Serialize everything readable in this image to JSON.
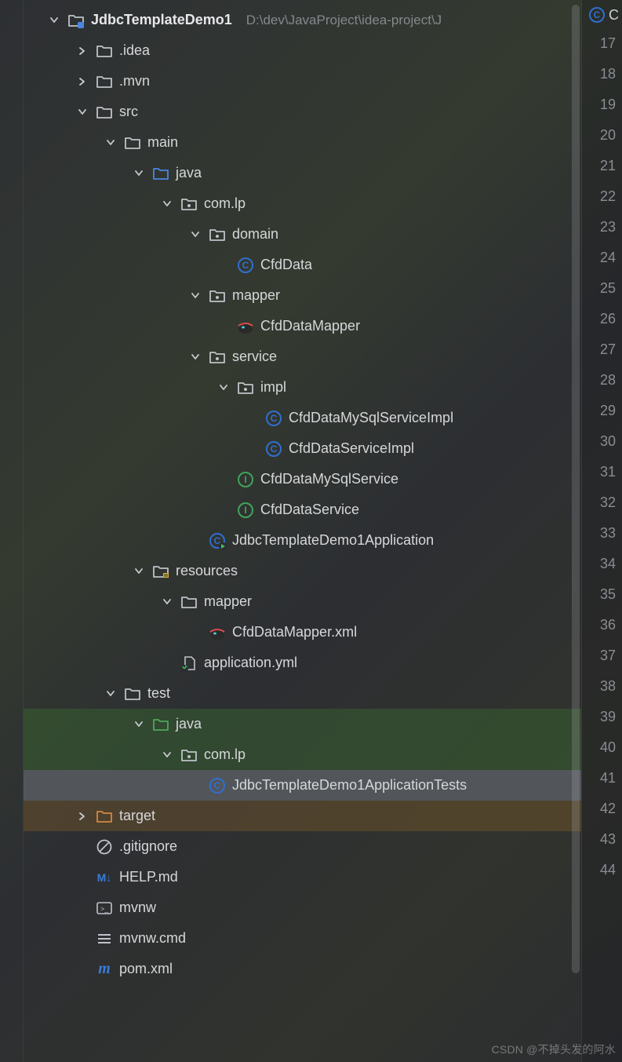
{
  "project": {
    "name": "JdbcTemplateDemo1",
    "path": "D:\\dev\\JavaProject\\idea-project\\J"
  },
  "gutter": {
    "top_letter": "C",
    "start": 17,
    "end": 44
  },
  "tree": [
    {
      "id": "root",
      "depth": 0,
      "arrow": "down",
      "icon": "module-folder",
      "label": "JdbcTemplateDemo1",
      "bold": true,
      "suffix_path": true
    },
    {
      "id": "idea",
      "depth": 1,
      "arrow": "right",
      "icon": "folder",
      "label": ".idea"
    },
    {
      "id": "mvn",
      "depth": 1,
      "arrow": "right",
      "icon": "folder",
      "label": ".mvn"
    },
    {
      "id": "src",
      "depth": 1,
      "arrow": "down",
      "icon": "folder",
      "label": "src"
    },
    {
      "id": "main",
      "depth": 2,
      "arrow": "down",
      "icon": "folder",
      "label": "main"
    },
    {
      "id": "java",
      "depth": 3,
      "arrow": "down",
      "icon": "folder-src",
      "label": "java"
    },
    {
      "id": "pkg",
      "depth": 4,
      "arrow": "down",
      "icon": "folder-pkg",
      "label": "com.lp"
    },
    {
      "id": "domain",
      "depth": 5,
      "arrow": "down",
      "icon": "folder-pkg",
      "label": "domain"
    },
    {
      "id": "CfdData",
      "depth": 6,
      "arrow": "none",
      "icon": "class-c",
      "label": "CfdData"
    },
    {
      "id": "mapper",
      "depth": 5,
      "arrow": "down",
      "icon": "folder-pkg",
      "label": "mapper"
    },
    {
      "id": "CfdDataMapper",
      "depth": 6,
      "arrow": "none",
      "icon": "mybatis",
      "label": "CfdDataMapper"
    },
    {
      "id": "service",
      "depth": 5,
      "arrow": "down",
      "icon": "folder-pkg",
      "label": "service"
    },
    {
      "id": "impl",
      "depth": 6,
      "arrow": "down",
      "icon": "folder-pkg",
      "label": "impl"
    },
    {
      "id": "CfdDataMySqlServiceImpl",
      "depth": 7,
      "arrow": "none",
      "icon": "class-c",
      "label": "CfdDataMySqlServiceImpl"
    },
    {
      "id": "CfdDataServiceImpl",
      "depth": 7,
      "arrow": "none",
      "icon": "class-c",
      "label": "CfdDataServiceImpl"
    },
    {
      "id": "CfdDataMySqlService",
      "depth": 6,
      "arrow": "none",
      "icon": "class-i",
      "label": "CfdDataMySqlService"
    },
    {
      "id": "CfdDataService",
      "depth": 6,
      "arrow": "none",
      "icon": "class-i",
      "label": "CfdDataService"
    },
    {
      "id": "JdbcTemplateDemo1Application",
      "depth": 5,
      "arrow": "none",
      "icon": "class-c-run",
      "label": "JdbcTemplateDemo1Application"
    },
    {
      "id": "resources",
      "depth": 3,
      "arrow": "down",
      "icon": "folder-res",
      "label": "resources"
    },
    {
      "id": "res-mapper",
      "depth": 4,
      "arrow": "down",
      "icon": "folder",
      "label": "mapper"
    },
    {
      "id": "CfdDataMapperXml",
      "depth": 5,
      "arrow": "none",
      "icon": "mybatis",
      "label": "CfdDataMapper.xml"
    },
    {
      "id": "applicationyml",
      "depth": 4,
      "arrow": "none",
      "icon": "yml",
      "label": "application.yml"
    },
    {
      "id": "test",
      "depth": 2,
      "arrow": "down",
      "icon": "folder",
      "label": "test"
    },
    {
      "id": "test-java",
      "depth": 3,
      "arrow": "down",
      "icon": "folder-test",
      "label": "java",
      "row": "green"
    },
    {
      "id": "test-pkg",
      "depth": 4,
      "arrow": "down",
      "icon": "folder-pkg",
      "label": "com.lp",
      "row": "green"
    },
    {
      "id": "JdbcTemplateDemo1ApplicationTests",
      "depth": 5,
      "arrow": "none",
      "icon": "class-c",
      "label": "JdbcTemplateDemo1ApplicationTests",
      "row": "selected"
    },
    {
      "id": "target",
      "depth": 1,
      "arrow": "right",
      "icon": "folder-excl",
      "label": "target",
      "row": "orange"
    },
    {
      "id": "gitignore",
      "depth": 1,
      "arrow": "none",
      "icon": "ignore",
      "label": ".gitignore"
    },
    {
      "id": "help",
      "depth": 1,
      "arrow": "none",
      "icon": "md",
      "label": "HELP.md"
    },
    {
      "id": "mvnw",
      "depth": 1,
      "arrow": "none",
      "icon": "shell",
      "label": "mvnw"
    },
    {
      "id": "mvnwcmd",
      "depth": 1,
      "arrow": "none",
      "icon": "cmd",
      "label": "mvnw.cmd"
    },
    {
      "id": "pom",
      "depth": 1,
      "arrow": "none",
      "icon": "maven",
      "label": "pom.xml"
    }
  ],
  "icon_text": {
    "md": "M↓",
    "shell": ">_",
    "maven": "m"
  },
  "watermark": "CSDN @不掉头发的阿水"
}
